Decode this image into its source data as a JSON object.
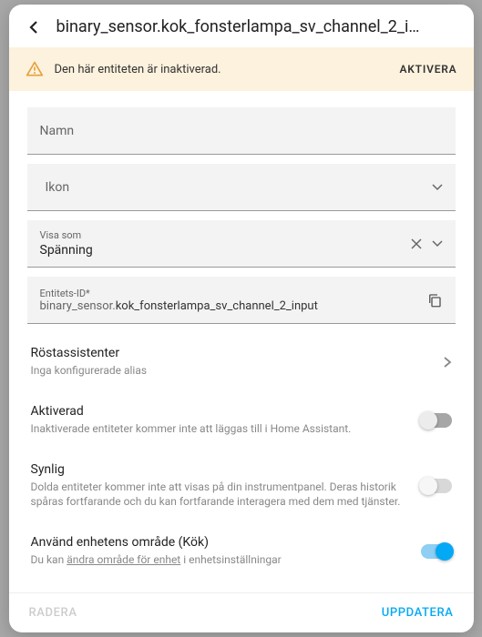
{
  "header": {
    "title": "binary_sensor.kok_fonsterlampa_sv_channel_2_i…"
  },
  "warning": {
    "text": "Den här entiteten är inaktiverad.",
    "action": "AKTIVERA"
  },
  "fields": {
    "name_label": "Namn",
    "icon_label": "Ikon",
    "show_as_label": "Visa som",
    "show_as_value": "Spänning",
    "entity_id_label": "Entitets-ID*",
    "entity_id_prefix": "binary_sensor.",
    "entity_id_value": "kok_fonsterlampa_sv_channel_2_input"
  },
  "rows": {
    "voice": {
      "title": "Röstassistenter",
      "sub": "Inga konfigurerade alias"
    },
    "enabled": {
      "title": "Aktiverad",
      "sub": "Inaktiverade entiteter kommer inte att läggas till i Home Assistant."
    },
    "visible": {
      "title": "Synlig",
      "sub": "Dolda entiteter kommer inte att visas på din instrumentpanel. Deras historik spåras fortfarande och du kan fortfarande interagera med dem med tjänster."
    },
    "area": {
      "title": "Använd enhetens område (Kök)",
      "sub_pre": "Du kan ",
      "sub_link": "ändra område för enhet",
      "sub_post": " i enhetsinställningar"
    }
  },
  "footer": {
    "delete": "RADERA",
    "update": "UPPDATERA"
  }
}
